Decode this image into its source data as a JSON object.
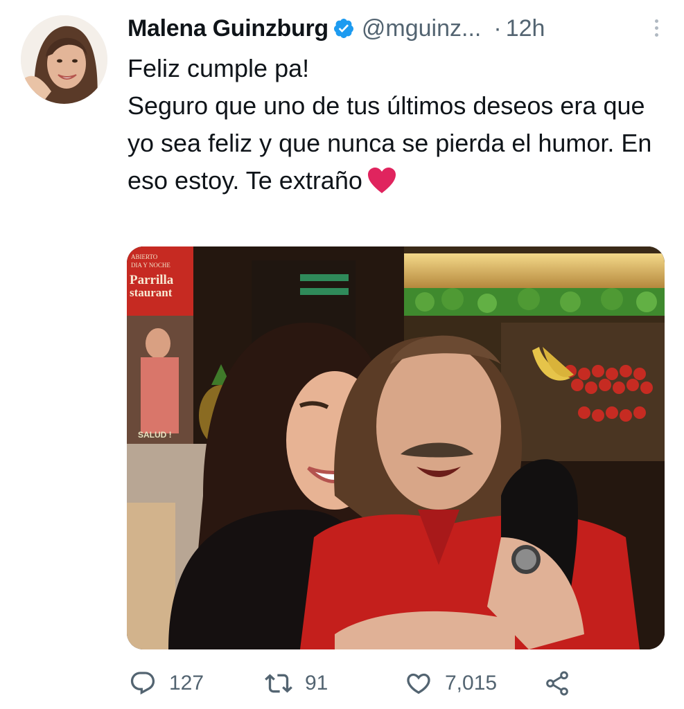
{
  "author": {
    "name": "Malena Guinzburg",
    "handle": "@mguinz...",
    "verified": true,
    "avatar_icon": "profile-photo"
  },
  "meta": {
    "separator": "·",
    "time": "12h"
  },
  "tweet": {
    "lines": [
      "Feliz cumple pa!",
      "Seguro que uno de tus últimos deseos era que yo sea feliz y que nunca se pierda el humor. En eso estoy. Te extraño"
    ],
    "emoji": "red-heart"
  },
  "media": {
    "poster_lines": [
      "ABIERTO",
      "DIA Y NOCHE",
      "Parrilla",
      "staurant"
    ],
    "poster_bottom_text": "SALUD !"
  },
  "actions": {
    "replies": "127",
    "retweets": "91",
    "likes": "7,015"
  },
  "colors": {
    "text": "#0f1419",
    "secondary": "#536471",
    "verified_blue": "#1d9bf0",
    "heart_red": "#e0245e"
  }
}
